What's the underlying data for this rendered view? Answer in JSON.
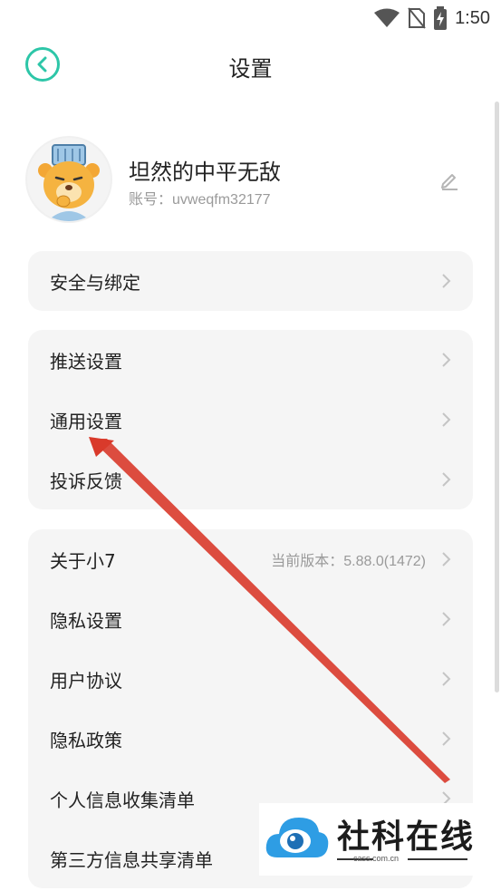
{
  "status_bar": {
    "time": "1:50",
    "icons": [
      "wifi-icon",
      "no-sim-icon",
      "battery-charging-icon"
    ]
  },
  "header": {
    "title": "设置",
    "back_icon": "back-arrow-circle-icon"
  },
  "profile": {
    "username": "坦然的中平无敌",
    "account_label": "账号：",
    "account_id": "uvweqfm32177",
    "edit_icon": "pencil-edit-icon"
  },
  "groups": [
    {
      "items": [
        {
          "label": "安全与绑定"
        }
      ]
    },
    {
      "items": [
        {
          "label": "推送设置"
        },
        {
          "label": "通用设置"
        },
        {
          "label": "投诉反馈"
        }
      ]
    },
    {
      "items": [
        {
          "label": "关于小7",
          "value": "当前版本：5.88.0(1472)"
        },
        {
          "label": "隐私设置"
        },
        {
          "label": "用户协议"
        },
        {
          "label": "隐私政策"
        },
        {
          "label": "个人信息收集清单"
        },
        {
          "label": "第三方信息共享清单"
        }
      ]
    }
  ],
  "watermark": {
    "title": "社科在线",
    "subtitle": "cass.com.cn"
  },
  "colors": {
    "accent": "#2dc6a8",
    "card_bg": "#f5f5f5",
    "annotation_arrow": "#d93a2b"
  }
}
